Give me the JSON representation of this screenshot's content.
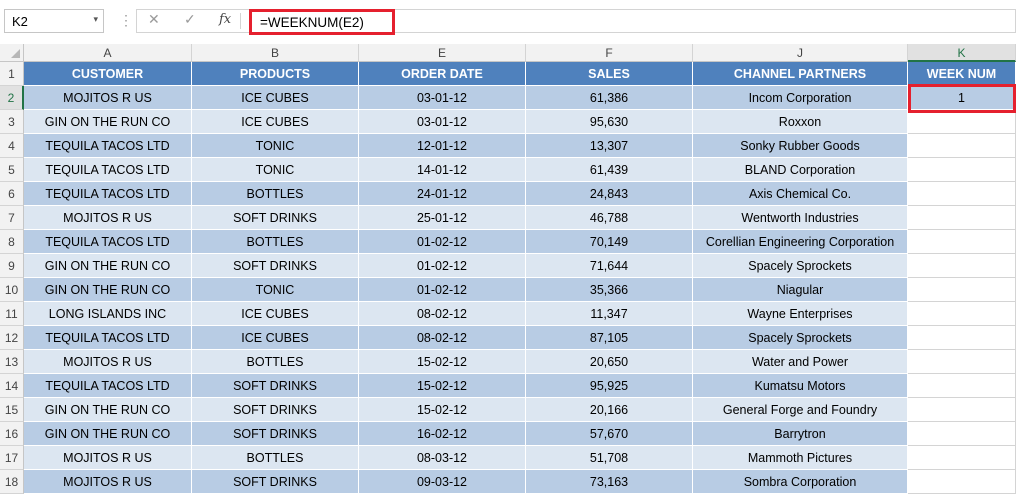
{
  "formula_bar": {
    "name_box": "K2",
    "name_box_arrow": "▾",
    "separator": "⋮",
    "cancel_glyph": "✕",
    "enter_glyph": "✓",
    "fx_label": "fx",
    "formula": "=WEEKNUM(E2)"
  },
  "columns": [
    "A",
    "B",
    "E",
    "F",
    "J",
    "K"
  ],
  "selected_column": "K",
  "selected_row": 2,
  "table_headers": [
    "CUSTOMER",
    "PRODUCTS",
    "ORDER DATE",
    "SALES",
    "CHANNEL PARTNERS",
    "WEEK NUM"
  ],
  "rows": [
    {
      "n": "2",
      "customer": "MOJITOS R US",
      "product": "ICE CUBES",
      "date": "03-01-12",
      "sales": "61,386",
      "partner": "Incom Corporation",
      "week": "1"
    },
    {
      "n": "3",
      "customer": "GIN ON THE RUN CO",
      "product": "ICE CUBES",
      "date": "03-01-12",
      "sales": "95,630",
      "partner": "Roxxon",
      "week": ""
    },
    {
      "n": "4",
      "customer": "TEQUILA TACOS LTD",
      "product": "TONIC",
      "date": "12-01-12",
      "sales": "13,307",
      "partner": "Sonky Rubber Goods",
      "week": ""
    },
    {
      "n": "5",
      "customer": "TEQUILA TACOS LTD",
      "product": "TONIC",
      "date": "14-01-12",
      "sales": "61,439",
      "partner": "BLAND Corporation",
      "week": ""
    },
    {
      "n": "6",
      "customer": "TEQUILA TACOS LTD",
      "product": "BOTTLES",
      "date": "24-01-12",
      "sales": "24,843",
      "partner": "Axis Chemical Co.",
      "week": ""
    },
    {
      "n": "7",
      "customer": "MOJITOS R US",
      "product": "SOFT DRINKS",
      "date": "25-01-12",
      "sales": "46,788",
      "partner": "Wentworth Industries",
      "week": ""
    },
    {
      "n": "8",
      "customer": "TEQUILA TACOS LTD",
      "product": "BOTTLES",
      "date": "01-02-12",
      "sales": "70,149",
      "partner": "Corellian Engineering Corporation",
      "week": ""
    },
    {
      "n": "9",
      "customer": "GIN ON THE RUN CO",
      "product": "SOFT DRINKS",
      "date": "01-02-12",
      "sales": "71,644",
      "partner": "Spacely Sprockets",
      "week": ""
    },
    {
      "n": "10",
      "customer": "GIN ON THE RUN CO",
      "product": "TONIC",
      "date": "01-02-12",
      "sales": "35,366",
      "partner": "Niagular",
      "week": ""
    },
    {
      "n": "11",
      "customer": "LONG ISLANDS INC",
      "product": "ICE CUBES",
      "date": "08-02-12",
      "sales": "11,347",
      "partner": "Wayne Enterprises",
      "week": ""
    },
    {
      "n": "12",
      "customer": "TEQUILA TACOS LTD",
      "product": "ICE CUBES",
      "date": "08-02-12",
      "sales": "87,105",
      "partner": "Spacely Sprockets",
      "week": ""
    },
    {
      "n": "13",
      "customer": "MOJITOS R US",
      "product": "BOTTLES",
      "date": "15-02-12",
      "sales": "20,650",
      "partner": "Water and Power",
      "week": ""
    },
    {
      "n": "14",
      "customer": "TEQUILA TACOS LTD",
      "product": "SOFT DRINKS",
      "date": "15-02-12",
      "sales": "95,925",
      "partner": "Kumatsu Motors",
      "week": ""
    },
    {
      "n": "15",
      "customer": "GIN ON THE RUN CO",
      "product": "SOFT DRINKS",
      "date": "15-02-12",
      "sales": "20,166",
      "partner": "General Forge and Foundry",
      "week": ""
    },
    {
      "n": "16",
      "customer": "GIN ON THE RUN CO",
      "product": "SOFT DRINKS",
      "date": "16-02-12",
      "sales": "57,670",
      "partner": "Barrytron",
      "week": ""
    },
    {
      "n": "17",
      "customer": "MOJITOS R US",
      "product": "BOTTLES",
      "date": "08-03-12",
      "sales": "51,708",
      "partner": "Mammoth Pictures",
      "week": ""
    },
    {
      "n": "18",
      "customer": "MOJITOS R US",
      "product": "SOFT DRINKS",
      "date": "09-03-12",
      "sales": "73,163",
      "partner": "Sombra Corporation",
      "week": ""
    }
  ],
  "colors": {
    "header_fill": "#4f81bd",
    "band_dark": "#b8cce4",
    "band_light": "#dce6f1",
    "highlight": "#e5202e",
    "excel_green": "#217346"
  }
}
